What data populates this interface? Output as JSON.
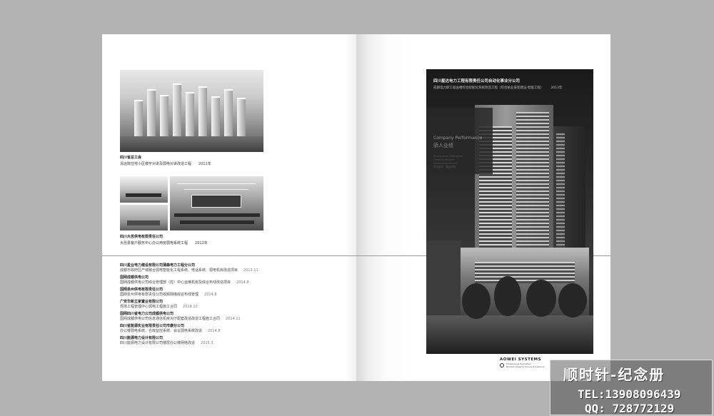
{
  "left_page": {
    "project1": {
      "title": "四川省总工会",
      "body": "清远院住宅小区楼宇对讲及弱电对讲改造工程",
      "year": "2011年"
    },
    "project2": {
      "title": "四川大邑供电有限责任公司",
      "body": "大邑县客户服务中心办公用房弱电系统工程",
      "year": "2012年"
    },
    "list": [
      {
        "title": "四川星业电力建设有限公司蒲森电力工程分公司",
        "body": "成都市政府区产城融合弱电智能化工程系统、电话系统、弱电机房改造项目",
        "date": "2013.11"
      },
      {
        "title": "国网成都供电公司",
        "body": "国网成都供电公司综合管理部（控）中心运维机房及综合布线改造项目",
        "date": "2014.8"
      },
      {
        "title": "国网泉州供电有限责任公司",
        "body": "国网泉州供电有限责任公司视频网络综合布线管理",
        "date": "2014.8"
      },
      {
        "title": "广安华新立家置业有限公司",
        "body": "现场工程管理中心弱电工程施工合同",
        "date": "2014.10"
      },
      {
        "title": "国网四川省电力公司成都供电公司",
        "body": "国网成都供电公司信息通信机房大厅配套改造改造工程施工合同",
        "date": "2014.11"
      },
      {
        "title": "四川省能源实业有限责任公司市康分公司",
        "body": "办公楼弱电系统、仓库监控系统、会议弱电系统改造",
        "date": "2014.8"
      },
      {
        "title": "四川能源电力设计有限公司",
        "body": "四川能源电力设计有限公司楼层办公楼网络改造",
        "date": "2015.3"
      }
    ]
  },
  "right_page": {
    "cover": {
      "heading": "四川星达电力工程有限责任公司自动化事业分公司",
      "subheading": "成都电力职工宿舍楼综合智能化系统改造工程（综合执业安装建设·智能工程）",
      "subheading_year": "2013年",
      "performance_en": "Company Performance",
      "performance_cn": "骄人业绩",
      "performance_small": [
        "Professional Dedication",
        "Creative Reliable",
        "Upstanding Pursuit",
        "专业服务 · 精益求精"
      ]
    },
    "brand": {
      "name": "AOWEI SYSTEMS",
      "tagline": [
        "Professional Dedication",
        "Brilliant Integrity Pursue Excellence"
      ]
    }
  },
  "watermark": {
    "title": "顺时针-纪念册",
    "tel": "TEL:13908096439",
    "qq": "QQ: 728772129"
  },
  "colors": {
    "background": "#b3b3b3",
    "page": "#ffffff",
    "cover": "#2a2a2a"
  }
}
